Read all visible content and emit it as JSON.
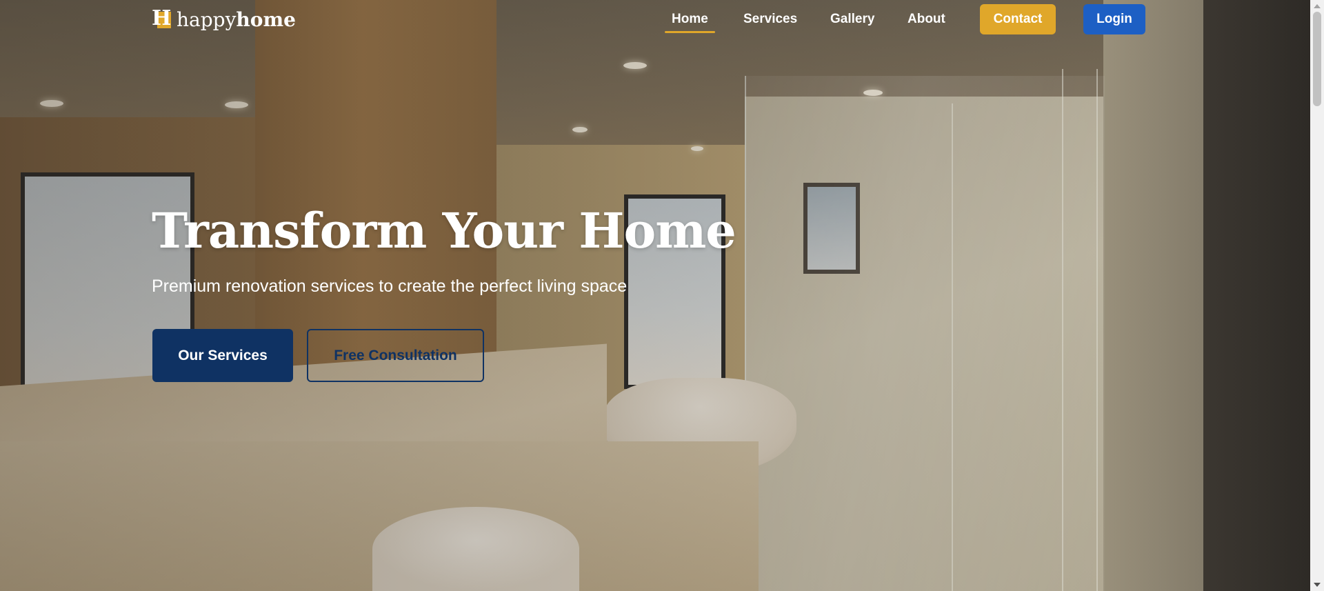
{
  "brand": {
    "logo_letter": "H",
    "name_part1": "happy",
    "name_part2": "home"
  },
  "nav": {
    "links": [
      {
        "label": "Home",
        "active": true
      },
      {
        "label": "Services",
        "active": false
      },
      {
        "label": "Gallery",
        "active": false
      },
      {
        "label": "About",
        "active": false
      }
    ],
    "contact_label": "Contact",
    "login_label": "Login"
  },
  "hero": {
    "title": "Transform Your Home",
    "subtitle": "Premium renovation services to create the perfect living space",
    "primary_button": "Our Services",
    "secondary_button": "Free Consultation"
  },
  "colors": {
    "accent": "#e0a72a",
    "primary_navy": "#0f3263",
    "login_blue": "#1d5fc4",
    "text_light": "#ffffff"
  }
}
